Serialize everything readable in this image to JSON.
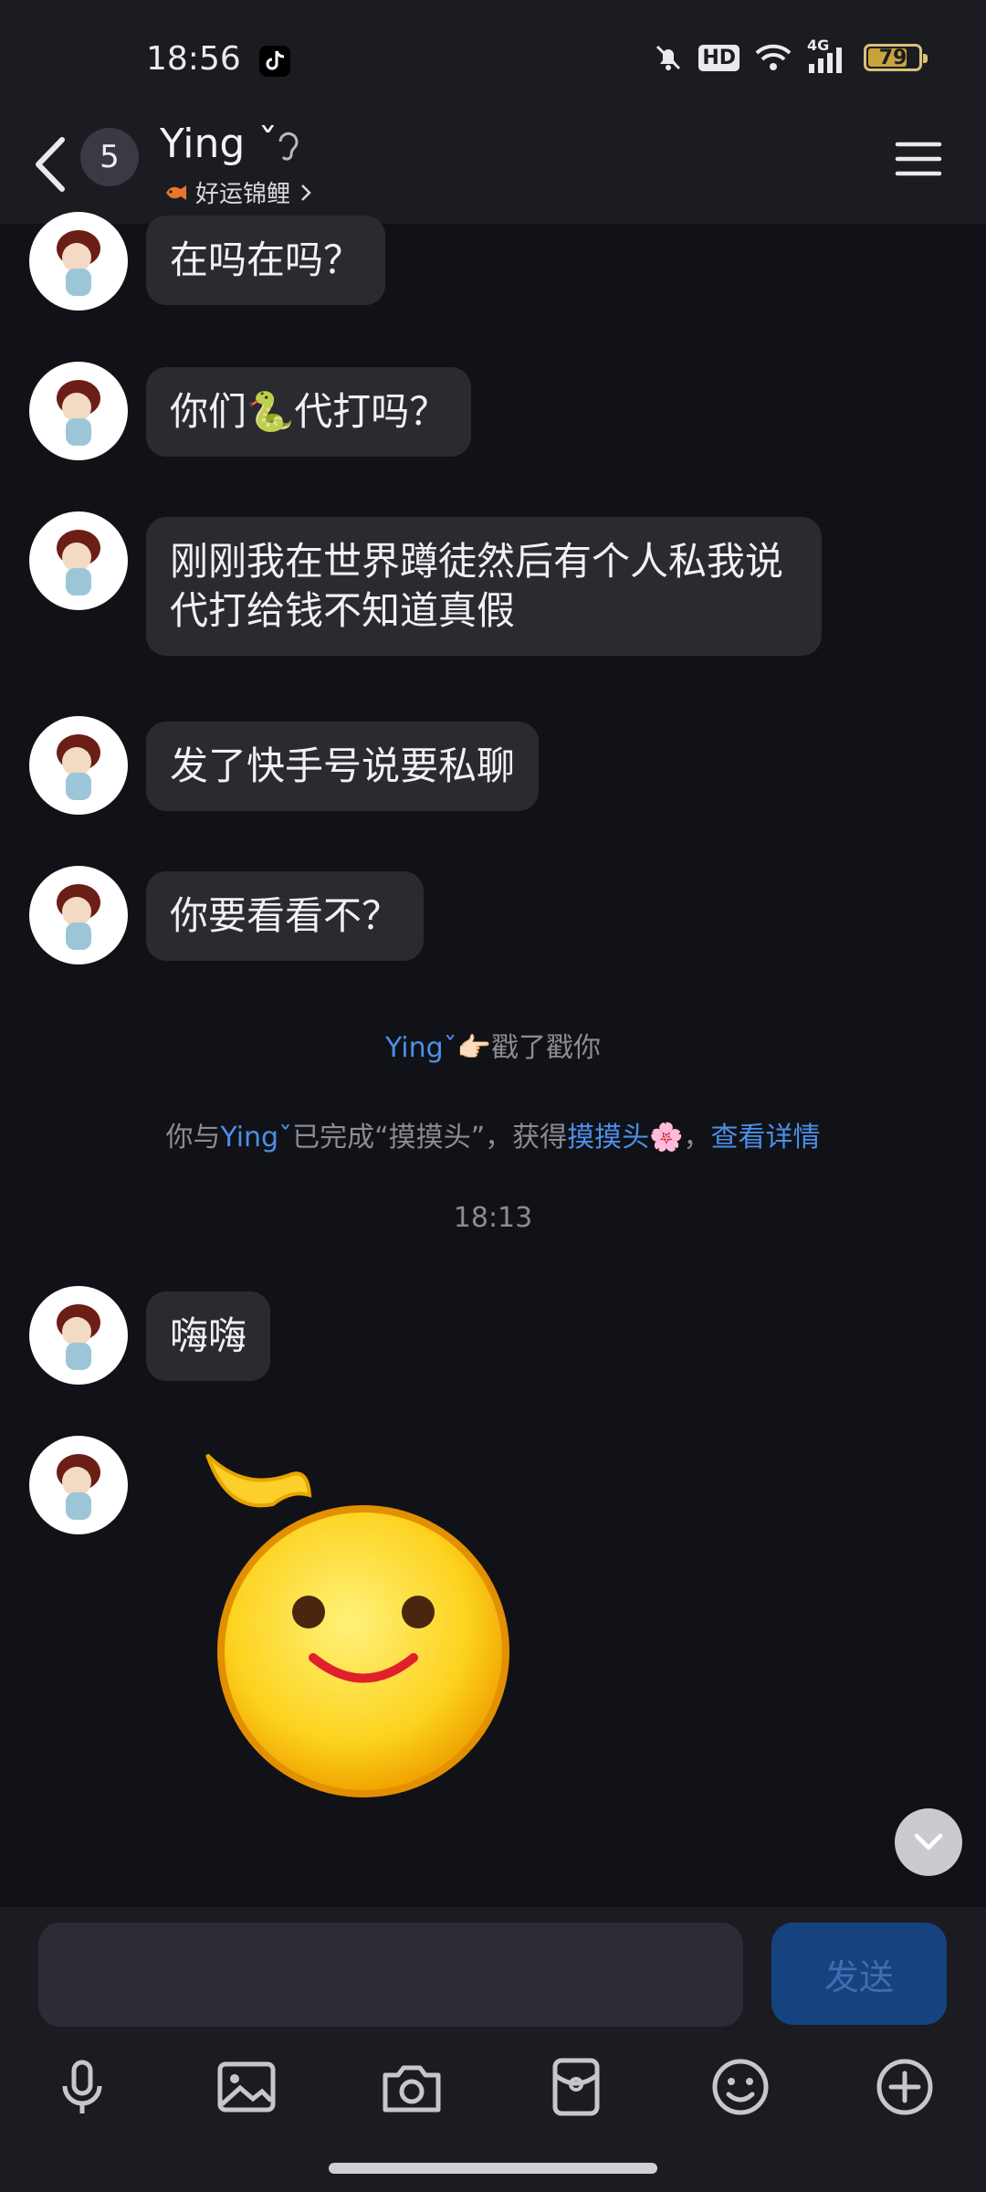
{
  "status_bar": {
    "time": "18:56",
    "network": "4G",
    "hd_label": "HD",
    "battery_percent": "79",
    "icons": [
      "tiktok-icon",
      "mute-bell-icon",
      "hd-icon",
      "wifi-icon",
      "signal-icon",
      "battery-icon"
    ]
  },
  "header": {
    "unread_count": "5",
    "contact_name": "Ying ˇ",
    "subtitle": "好运锦鲤",
    "icons": [
      "back-chevron-icon",
      "hearing-ear-icon",
      "koi-fish-icon",
      "chevron-right-icon",
      "menu-hamburger-icon"
    ]
  },
  "messages": [
    {
      "text": "在吗在吗？"
    },
    {
      "text": "你们🐍代打吗？"
    },
    {
      "text": "刚刚我在世界蹲徒然后有个人私我说代打给钱不知道真假"
    },
    {
      "text": "发了快手号说要私聊"
    },
    {
      "text": "你要看看不？"
    }
  ],
  "system": {
    "poke_name": "Yingˇ",
    "poke_text": "👉🏻戳了戳你",
    "task_prefix": "你与",
    "task_name": "Yingˇ",
    "task_middle": "已完成“摸摸头”，获得",
    "task_reward": "摸摸头",
    "task_reward_emoji": "🌸",
    "task_comma": "，",
    "task_link": "查看详情"
  },
  "timestamp": "18:13",
  "later_messages": [
    {
      "text": "嗨嗨"
    }
  ],
  "sticker": {
    "name": "pat-head-smiley-sticker"
  },
  "input": {
    "placeholder": "",
    "send_label": "发送"
  },
  "toolbar": {
    "icons": [
      "microphone-icon",
      "image-icon",
      "camera-icon",
      "red-packet-icon",
      "emoji-icon",
      "plus-icon"
    ]
  },
  "colors": {
    "background": "#111217",
    "bubble": "#2a2b31",
    "link": "#4c8ee8",
    "send_button": "#16437f"
  }
}
